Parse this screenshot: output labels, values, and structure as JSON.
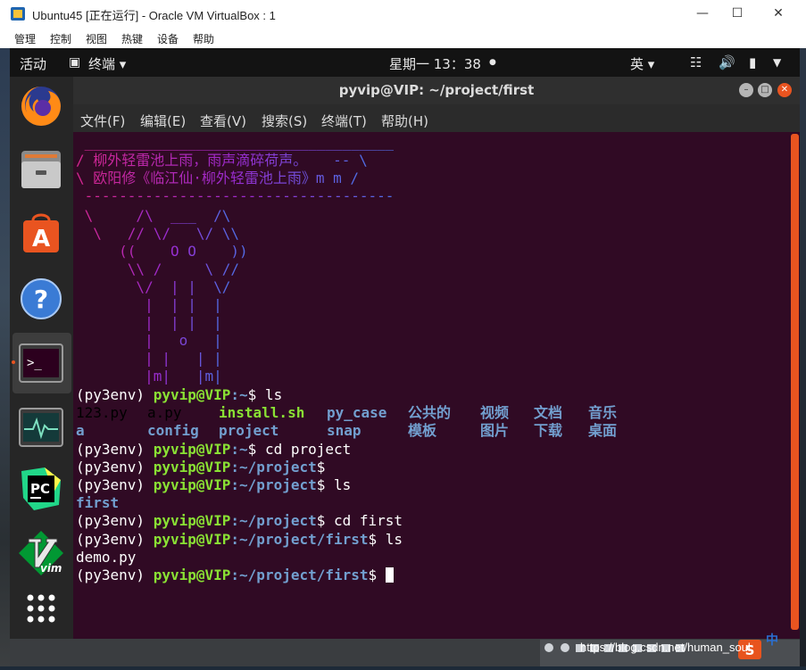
{
  "vbox": {
    "title": "Ubuntu45 [正在运行] - Oracle VM VirtualBox : 1",
    "menu": [
      "管理",
      "控制",
      "视图",
      "热键",
      "设备",
      "帮助"
    ]
  },
  "gnome": {
    "activities": "活动",
    "app_menu": "终端 ▾",
    "clock": "星期一 13：38",
    "input_method": "英 ▾"
  },
  "terminal": {
    "title": "pyvip@VIP: ~/project/first",
    "menu": [
      "文件(F)",
      "编辑(E)",
      "查看(V)",
      "搜索(S)",
      "终端(T)",
      "帮助(H)"
    ],
    "ascii_lines": [
      " ____________________________________",
      "/ 柳外轻雷池上雨，雨声滴碎荷声。   -- \\",
      "\\ 欧阳修《临江仙·柳外轻雷池上雨》m m /",
      " ------------------------------------",
      " \\     /\\  ___  /\\",
      "  \\   // \\/   \\/ \\\\",
      "     ((    O O    ))",
      "      \\\\ /     \\ //",
      "       \\/  | |  \\/",
      "        |  | |  |",
      "        |  | |  |",
      "        |   o   |",
      "        | |   | |",
      "        |m|   |m|"
    ],
    "prompt_env": "(py3env) ",
    "prompt_user": "pyvip@VIP",
    "lines": [
      {
        "path": ":~",
        "cmd": "$ ls"
      },
      {
        "path": ":~",
        "cmd": "$ cd project"
      },
      {
        "path": ":~/project",
        "cmd": "$"
      },
      {
        "path": ":~/project",
        "cmd": "$ ls"
      },
      {
        "path": ":~/project",
        "cmd": "$ cd first"
      },
      {
        "path": ":~/project/first",
        "cmd": "$ ls"
      },
      {
        "path": ":~/project/first",
        "cmd": "$ "
      }
    ],
    "ls_home_row1": [
      {
        "name": "123.py",
        "type": "file"
      },
      {
        "name": "a.py",
        "type": "file"
      },
      {
        "name": "install.sh",
        "type": "exec"
      },
      {
        "name": "py_case",
        "type": "dir"
      },
      {
        "name": "公共的",
        "type": "dir"
      },
      {
        "name": "视频",
        "type": "dir"
      },
      {
        "name": "文档",
        "type": "dir"
      },
      {
        "name": "音乐",
        "type": "dir"
      }
    ],
    "ls_home_row2": [
      {
        "name": "a",
        "type": "dir"
      },
      {
        "name": "config",
        "type": "dir"
      },
      {
        "name": "project",
        "type": "dir"
      },
      {
        "name": "snap",
        "type": "dir"
      },
      {
        "name": "模板",
        "type": "dir"
      },
      {
        "name": "图片",
        "type": "dir"
      },
      {
        "name": "下载",
        "type": "dir"
      },
      {
        "name": "桌面",
        "type": "dir"
      }
    ],
    "ls_project": "first",
    "ls_first": "demo.py"
  },
  "watermark": "https://blog.csdn.net/human_soul",
  "tray_ime": "中",
  "colors": {
    "terminal_bg": "#300a24",
    "prompt_green": "#8ae234",
    "dir_blue": "#729fcf",
    "ubuntu_orange": "#e95420"
  }
}
